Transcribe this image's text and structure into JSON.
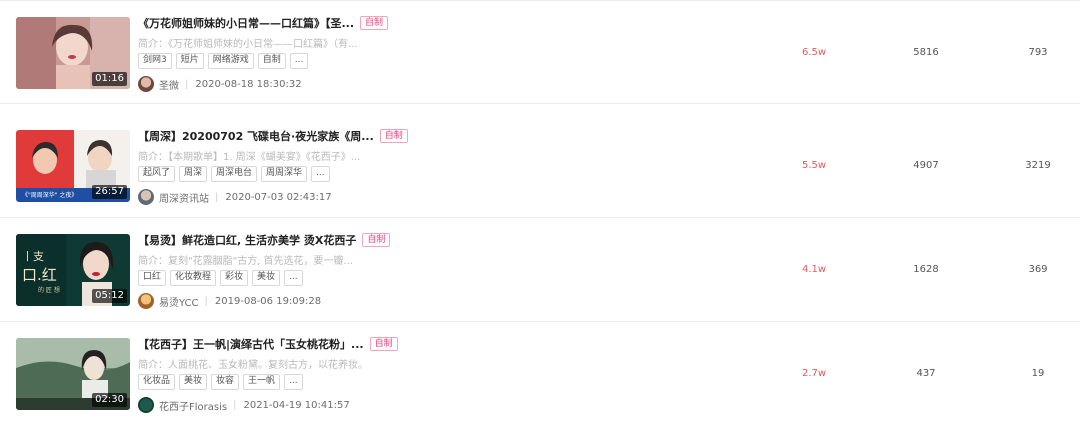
{
  "rows": [
    {
      "title": "《万花师姐师妹的小日常——口红篇》【圣...",
      "badge": "自制",
      "desc": "简介：《万花师姐师妹的小日常——口红篇》（有...",
      "tags": [
        "剑网3",
        "短片",
        "网络游戏",
        "自制",
        "..."
      ],
      "duration": "01:16",
      "author": "圣微",
      "date": "2020-08-18 18:30:32",
      "metric1": "6.5w",
      "metric2": "5816",
      "metric3": "793"
    },
    {
      "title": "【周深】20200702 飞碟电台·夜光家族《周...",
      "badge": "自制",
      "desc": "简介：【本期歌单】1. 周深《蝴美宴》《花西子》...",
      "tags": [
        "起风了",
        "周深",
        "周深电台",
        "周周深华",
        "..."
      ],
      "duration": "26:57",
      "author": "周深资讯站",
      "date": "2020-07-03 02:43:17",
      "metric1": "5.5w",
      "metric2": "4907",
      "metric3": "3219"
    },
    {
      "title": "【易烫】鲜花造口红, 生活亦美学 烫X花西子",
      "badge": "自制",
      "desc": "简介：复刻\"花露胭脂\"古方, 首先选花，要一瓣...",
      "tags": [
        "口红",
        "化妆教程",
        "彩妆",
        "美妆",
        "..."
      ],
      "duration": "05:12",
      "author": "易烫YCC",
      "date": "2019-08-06 19:09:28",
      "metric1": "4.1w",
      "metric2": "1628",
      "metric3": "369"
    },
    {
      "title": "【花西子】王一帆|演绎古代「玉女桃花粉」...",
      "badge": "自制",
      "desc": "简介：人面桃花、玉女粉黛。复刻古方，以花养妆。",
      "tags": [
        "化妆品",
        "美妆",
        "妆容",
        "王一帆",
        "..."
      ],
      "duration": "02:30",
      "author": "花西子Florasis",
      "date": "2021-04-19 10:41:57",
      "metric1": "2.7w",
      "metric2": "437",
      "metric3": "19"
    }
  ]
}
